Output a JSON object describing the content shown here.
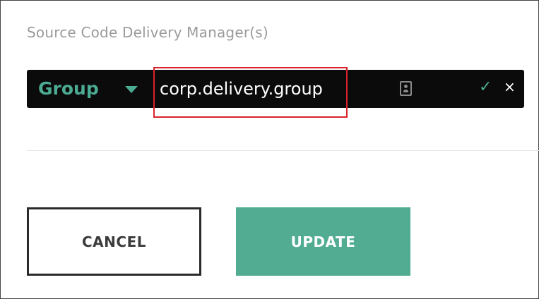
{
  "field": {
    "label": "Source Code Delivery Manager(s)"
  },
  "input_bar": {
    "type_label": "Group",
    "value": "corp.delivery.group",
    "check_glyph": "✓",
    "close_glyph": "×"
  },
  "buttons": {
    "cancel_label": "CANCEL",
    "update_label": "UPDATE"
  },
  "colors": {
    "accent": "#4cab93",
    "update_bg": "#52ac92",
    "bar_bg": "#0b0b0b",
    "highlight": "#d9232b"
  },
  "icons": [
    "caret-down-icon",
    "contact-card-icon",
    "check-icon",
    "close-icon"
  ]
}
